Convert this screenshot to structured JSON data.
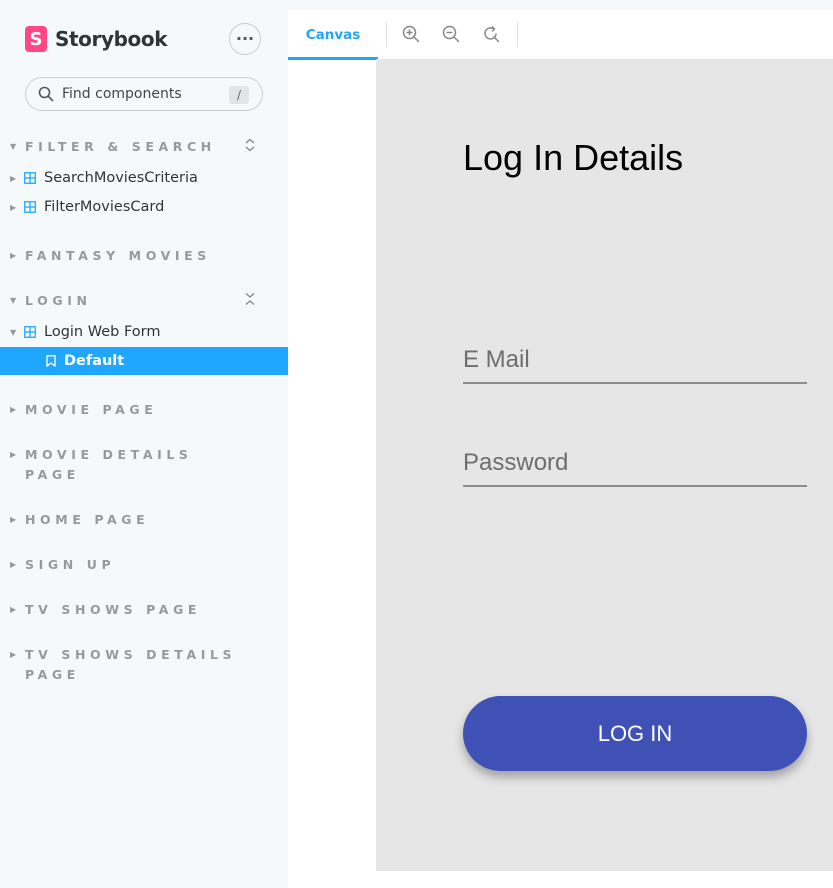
{
  "sidebar": {
    "brand": {
      "logo_letter": "S",
      "name": "Storybook",
      "accent": "#ff4785"
    },
    "menu_icon": "ellipsis-icon",
    "search": {
      "placeholder": "Find components",
      "shortcut": "/"
    },
    "groups": [
      {
        "label": "FILTER & SEARCH",
        "expanded": true
      },
      {
        "label": "FANTASY MOVIES",
        "expanded": false
      },
      {
        "label": "LOGIN",
        "expanded": true
      },
      {
        "label": "MOVIE PAGE",
        "expanded": false
      },
      {
        "label": "MOVIE DETAILS PAGE",
        "expanded": false
      },
      {
        "label": "HOME PAGE",
        "expanded": false
      },
      {
        "label": "SIGN UP",
        "expanded": false
      },
      {
        "label": "TV SHOWS PAGE",
        "expanded": false
      },
      {
        "label": "TV SHOWS DETAILS PAGE",
        "expanded": false
      }
    ],
    "components": [
      {
        "label": "SearchMoviesCriteria"
      },
      {
        "label": "FilterMoviesCard"
      },
      {
        "label": "Login Web Form"
      }
    ],
    "selected_story": "Default",
    "selected_color": "#1ea7fd"
  },
  "toolbar": {
    "tab_label": "Canvas",
    "tools": [
      "zoom-in-icon",
      "zoom-out-icon",
      "reset-zoom-icon"
    ]
  },
  "form": {
    "title": "Log In Details",
    "email_placeholder": "E Mail",
    "password_placeholder": "Password",
    "submit_label": "LOG IN",
    "button_color": "#3f51b5"
  }
}
